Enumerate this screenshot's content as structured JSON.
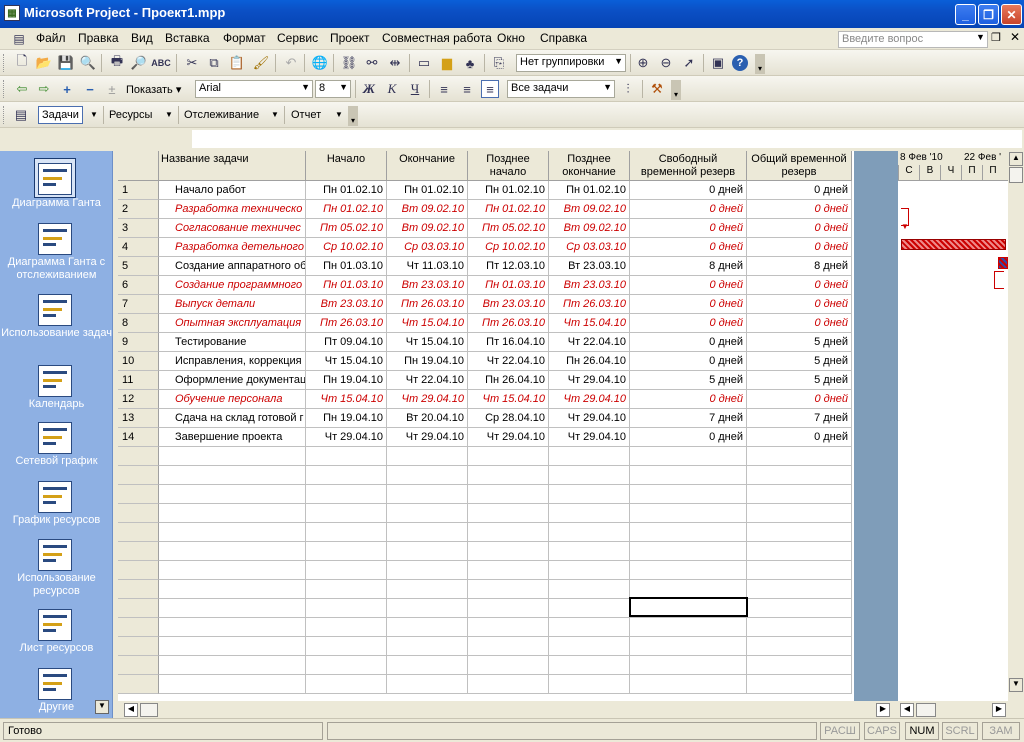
{
  "window": {
    "title": "Microsoft Project - Проект1.mpp",
    "app_icon": "project-icon"
  },
  "menu": {
    "items": [
      "Файл",
      "Правка",
      "Вид",
      "Вставка",
      "Формат",
      "Сервис",
      "Проект",
      "Совместная работа",
      "Окно",
      "Справка"
    ],
    "help_placeholder": "Введите вопрос"
  },
  "toolbar1": {
    "grouping": "Нет группировки"
  },
  "toolbar2": {
    "show_label": "Показать",
    "font": "Arial",
    "size": "8",
    "bold": "Ж",
    "italic": "К",
    "underline": "Ч",
    "filter": "Все задачи"
  },
  "toolbar3": {
    "tasks": "Задачи",
    "resources": "Ресурсы",
    "tracking": "Отслеживание",
    "report": "Отчет"
  },
  "viewbar": {
    "items": [
      "Диаграмма Ганта",
      "Диаграмма Ганта с отслеживанием",
      "Использование задач",
      "Календарь",
      "Сетевой график",
      "График ресурсов",
      "Использование ресурсов",
      "Лист ресурсов",
      "Другие"
    ]
  },
  "table": {
    "columns": [
      "",
      "Название задачи",
      "Начало",
      "Окончание",
      "Позднее\nначало",
      "Позднее\nокончание",
      "Свободный\nвременной резерв",
      "Общий временной\nрезерв"
    ],
    "rows": [
      {
        "id": "1",
        "name": "Начало работ",
        "start": "Пн 01.02.10",
        "finish": "Пн 01.02.10",
        "ls": "Пн 01.02.10",
        "lf": "Пн 01.02.10",
        "free": "0 дней",
        "total": "0 дней",
        "critical": false
      },
      {
        "id": "2",
        "name": "Разработка техническо",
        "start": "Пн 01.02.10",
        "finish": "Вт 09.02.10",
        "ls": "Пн 01.02.10",
        "lf": "Вт 09.02.10",
        "free": "0 дней",
        "total": "0 дней",
        "critical": true
      },
      {
        "id": "3",
        "name": "Согласование техничес",
        "start": "Пт 05.02.10",
        "finish": "Вт 09.02.10",
        "ls": "Пт 05.02.10",
        "lf": "Вт 09.02.10",
        "free": "0 дней",
        "total": "0 дней",
        "critical": true
      },
      {
        "id": "4",
        "name": "Разработка детельного",
        "start": "Ср 10.02.10",
        "finish": "Ср 03.03.10",
        "ls": "Ср 10.02.10",
        "lf": "Ср 03.03.10",
        "free": "0 дней",
        "total": "0 дней",
        "critical": true
      },
      {
        "id": "5",
        "name": "Создание аппаратного об",
        "start": "Пн 01.03.10",
        "finish": "Чт 11.03.10",
        "ls": "Пт 12.03.10",
        "lf": "Вт 23.03.10",
        "free": "8 дней",
        "total": "8 дней",
        "critical": false
      },
      {
        "id": "6",
        "name": "Создание программного",
        "start": "Пн 01.03.10",
        "finish": "Вт 23.03.10",
        "ls": "Пн 01.03.10",
        "lf": "Вт 23.03.10",
        "free": "0 дней",
        "total": "0 дней",
        "critical": true
      },
      {
        "id": "7",
        "name": "Выпуск детали",
        "start": "Вт 23.03.10",
        "finish": "Пт 26.03.10",
        "ls": "Вт 23.03.10",
        "lf": "Пт 26.03.10",
        "free": "0 дней",
        "total": "0 дней",
        "critical": true
      },
      {
        "id": "8",
        "name": "Опытная эксплуатация",
        "start": "Пт 26.03.10",
        "finish": "Чт 15.04.10",
        "ls": "Пт 26.03.10",
        "lf": "Чт 15.04.10",
        "free": "0 дней",
        "total": "0 дней",
        "critical": true
      },
      {
        "id": "9",
        "name": "Тестирование",
        "start": "Пт 09.04.10",
        "finish": "Чт 15.04.10",
        "ls": "Пт 16.04.10",
        "lf": "Чт 22.04.10",
        "free": "0 дней",
        "total": "5 дней",
        "critical": false
      },
      {
        "id": "10",
        "name": "Исправления, коррекция",
        "start": "Чт 15.04.10",
        "finish": "Пн 19.04.10",
        "ls": "Чт 22.04.10",
        "lf": "Пн 26.04.10",
        "free": "0 дней",
        "total": "5 дней",
        "critical": false
      },
      {
        "id": "11",
        "name": "Оформление документац",
        "start": "Пн 19.04.10",
        "finish": "Чт 22.04.10",
        "ls": "Пн 26.04.10",
        "lf": "Чт 29.04.10",
        "free": "5 дней",
        "total": "5 дней",
        "critical": false
      },
      {
        "id": "12",
        "name": "Обучение персонала",
        "start": "Чт 15.04.10",
        "finish": "Чт 29.04.10",
        "ls": "Чт 15.04.10",
        "lf": "Чт 29.04.10",
        "free": "0 дней",
        "total": "0 дней",
        "critical": true
      },
      {
        "id": "13",
        "name": "Сдача на склад готовой г",
        "start": "Пн 19.04.10",
        "finish": "Вт 20.04.10",
        "ls": "Ср 28.04.10",
        "lf": "Чт 29.04.10",
        "free": "7 дней",
        "total": "7 дней",
        "critical": false
      },
      {
        "id": "14",
        "name": "Завершение проекта",
        "start": "Чт 29.04.10",
        "finish": "Чт 29.04.10",
        "ls": "Чт 29.04.10",
        "lf": "Чт 29.04.10",
        "free": "0 дней",
        "total": "0 дней",
        "critical": false
      }
    ]
  },
  "gantt": {
    "weeks": [
      "8 Фев '10",
      "22 Фев '"
    ],
    "days": [
      "С",
      "В",
      "Ч",
      "П",
      "П"
    ]
  },
  "status": {
    "text": "Готово",
    "indicators": [
      "РАСШ",
      "CAPS",
      "NUM",
      "SCRL",
      "ЗАМ"
    ],
    "active": "NUM"
  }
}
